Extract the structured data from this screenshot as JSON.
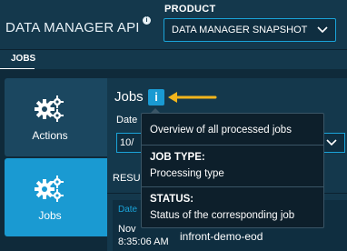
{
  "header": {
    "app_title": "DATA MANAGER API",
    "info_icon": "info-icon",
    "product_label": "PRODUCT",
    "product_value": "DATA MANAGER SNAPSHOT"
  },
  "nav": {
    "tabs": [
      {
        "label": "JOBS",
        "active": true
      }
    ]
  },
  "sidebar": {
    "items": [
      {
        "label": "Actions",
        "icon": "gears-icon",
        "active": false
      },
      {
        "label": "Jobs",
        "icon": "gears-icon",
        "active": true
      }
    ]
  },
  "main": {
    "title": "Jobs",
    "info_button": "i",
    "date_label": "Date",
    "date_value": "10/",
    "results_label": "RESU",
    "table": {
      "header_date": "Date",
      "row": {
        "date_line1": "Nov",
        "date_line2": "8:35:06 AM",
        "name": "infront-demo-eod"
      }
    }
  },
  "tooltip": {
    "overview": "Overview of all processed jobs",
    "job_type_heading": "JOB TYPE:",
    "job_type_text": "Processing type",
    "status_heading": "STATUS:",
    "status_text": "Status of the corresponding job"
  },
  "colors": {
    "accent": "#1a9ad2",
    "arrow": "#f2b51c",
    "background": "#0f2a3a",
    "panel": "#14384c",
    "tooltip_bg": "#0d1f2b"
  }
}
